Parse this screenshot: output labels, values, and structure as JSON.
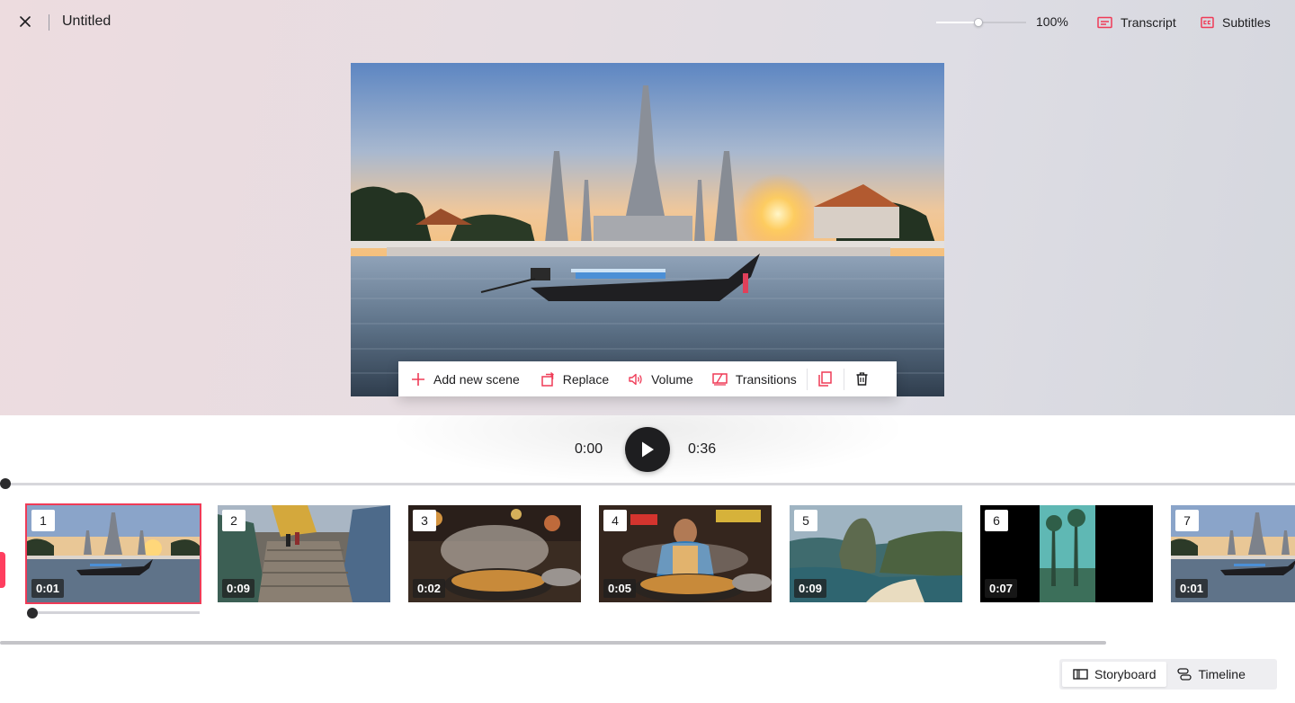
{
  "header": {
    "document_title": "Untitled",
    "zoom_label": "100%",
    "zoom_level": 0.47,
    "transcript_label": "Transcript",
    "subtitles_label": "Subtitles"
  },
  "toolbar": {
    "add_scene_label": "Add new scene",
    "replace_label": "Replace",
    "volume_label": "Volume",
    "transitions_label": "Transitions"
  },
  "player": {
    "current_time": "0:00",
    "total_time": "0:36",
    "progress": 0.0
  },
  "scenes": [
    {
      "number": "1",
      "duration": "0:01",
      "selected": true
    },
    {
      "number": "2",
      "duration": "0:09",
      "selected": false
    },
    {
      "number": "3",
      "duration": "0:02",
      "selected": false
    },
    {
      "number": "4",
      "duration": "0:05",
      "selected": false
    },
    {
      "number": "5",
      "duration": "0:09",
      "selected": false
    },
    {
      "number": "6",
      "duration": "0:07",
      "selected": false
    },
    {
      "number": "7",
      "duration": "0:01",
      "selected": false
    }
  ],
  "scene_volume": 0.0,
  "view_switch": {
    "storyboard_label": "Storyboard",
    "timeline_label": "Timeline",
    "active": "storyboard"
  },
  "colors": {
    "accent": "#ef3b57",
    "play_button": "#1e1e20"
  }
}
